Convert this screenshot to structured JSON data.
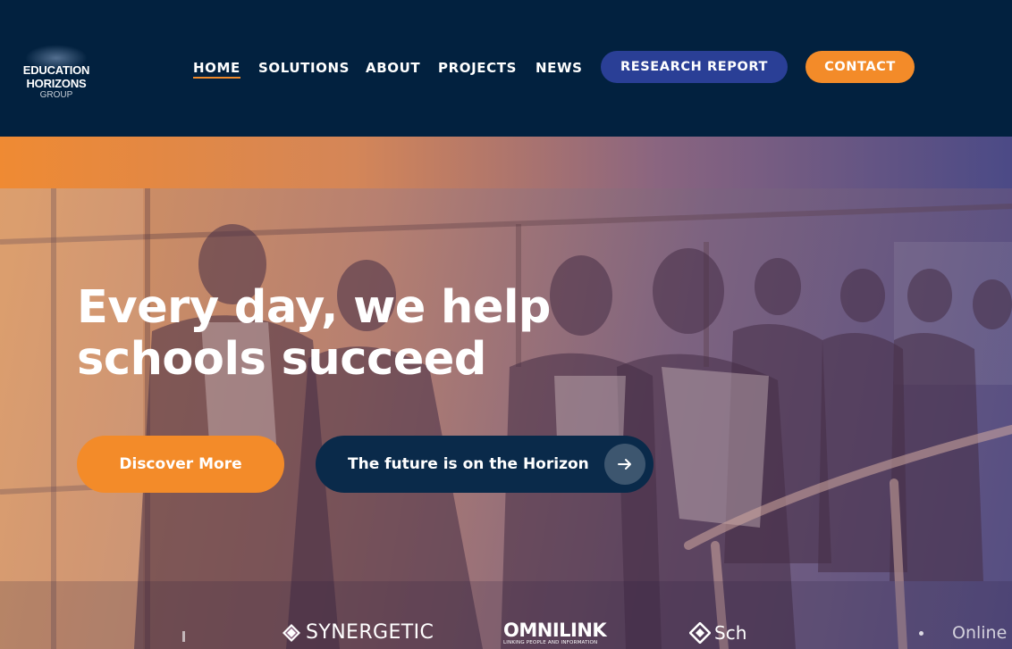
{
  "brand": {
    "line1": "EDUCATION",
    "line2": "HORIZONS",
    "line3": "GROUP"
  },
  "nav": {
    "items": [
      {
        "label": "HOME",
        "active": true
      },
      {
        "label": "SOLUTIONS"
      },
      {
        "label": "ABOUT"
      },
      {
        "label": "PROJECTS"
      },
      {
        "label": "NEWS"
      }
    ],
    "research_report": "RESEARCH REPORT",
    "contact": "CONTACT"
  },
  "hero": {
    "title_line1": "Every day, we help",
    "title_line2": "schools succeed",
    "discover_button": "Discover More",
    "future_button": "The future is on the Horizon",
    "arrow_icon": "arrow-right-icon"
  },
  "partner_logos": {
    "synergetic": "SYNERGETIC",
    "omnilink": "OMNILINK",
    "omnilink_tagline": "LINKING PEOPLE AND INFORMATION",
    "school": "Sch",
    "online": "Online"
  },
  "colors": {
    "header_bg": "#02213f",
    "accent_orange": "#f38b29",
    "report_blue": "#2a3f96",
    "future_button_bg": "#0a2a4a",
    "nav_active_underline": "#f08a2b"
  }
}
